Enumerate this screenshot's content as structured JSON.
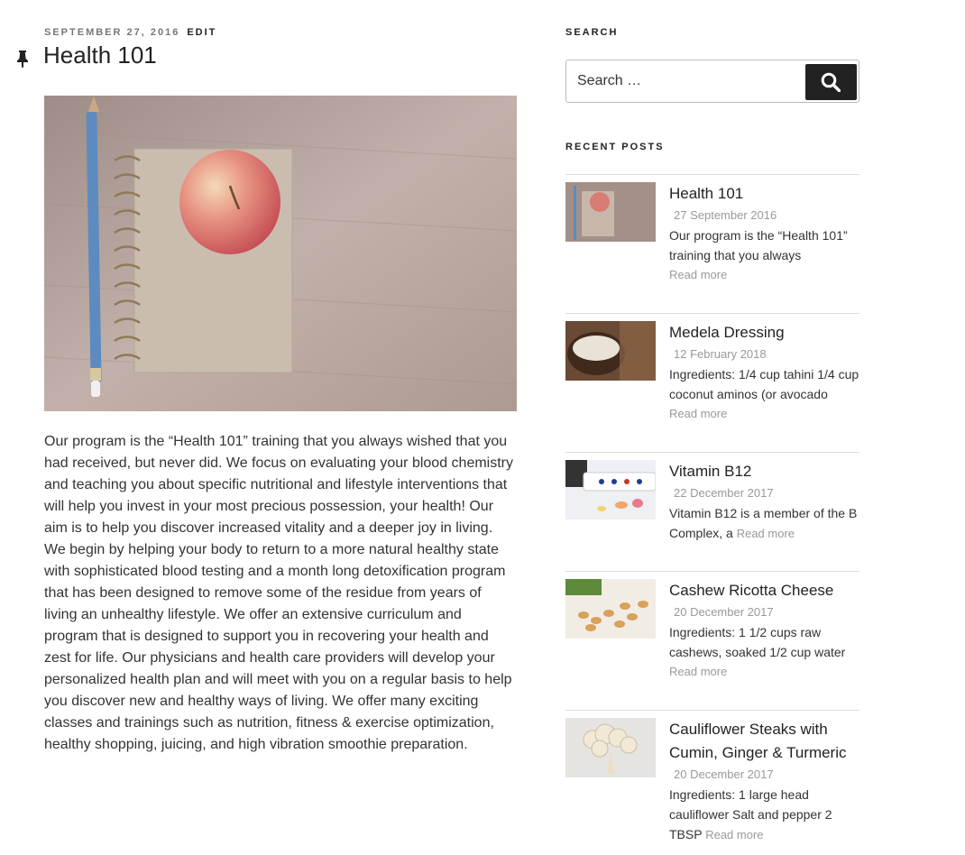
{
  "post": {
    "date": "SEPTEMBER 27, 2016",
    "edit": "EDIT",
    "title": "Health 101",
    "content": "Our program is the “Health 101” training that you always wished that you had received, but never did. We focus on evaluating your blood chemistry and teaching you about specific nutritional and lifestyle interventions that will help you invest in your most precious possession, your health! Our aim is to help you discover increased vitality and a deeper joy in living. We begin by helping your body to return to a more natural healthy state with sophisticated blood testing and a month long detoxification program that has been designed to remove some of the residue from years of living an unhealthy lifestyle. We offer an extensive curriculum and program that is designed to support you in recovering your health and zest for life. Our physicians and health care providers will develop your personalized health plan and will meet with you on a regular basis to help you discover new and healthy ways of living. We offer many exciting classes and trainings such as nutrition, fitness & exercise optimization, healthy shopping, juicing, and high vibration smoothie preparation."
  },
  "sidebar": {
    "search_title": "SEARCH",
    "search_placeholder": "Search …",
    "recent_title": "RECENT POSTS",
    "posts": [
      {
        "title": "Health 101",
        "date": "27 September 2016",
        "excerpt": "Our program is the “Health 101” training that you always",
        "more": "Read more"
      },
      {
        "title": "Medela Dressing",
        "date": "12 February 2018",
        "excerpt": "Ingredients: 1/4 cup tahini 1/4 cup coconut aminos (or avocado",
        "more": "Read more"
      },
      {
        "title": "Vitamin B12",
        "date": "22 December 2017",
        "excerpt": "Vitamin B12 is a member of the B Complex, a",
        "more": "Read more"
      },
      {
        "title": "Cashew Ricotta Cheese",
        "date": "20 December 2017",
        "excerpt": "Ingredients: 1 1/2 cups raw cashews, soaked 1/2 cup water",
        "more": "Read more"
      },
      {
        "title": "Cauliflower Steaks with Cumin, Ginger & Turmeric",
        "date": "20 December 2017",
        "excerpt": "Ingredients: 1 large head cauliflower Salt and pepper 2 TBSP",
        "more": "Read more"
      }
    ]
  }
}
